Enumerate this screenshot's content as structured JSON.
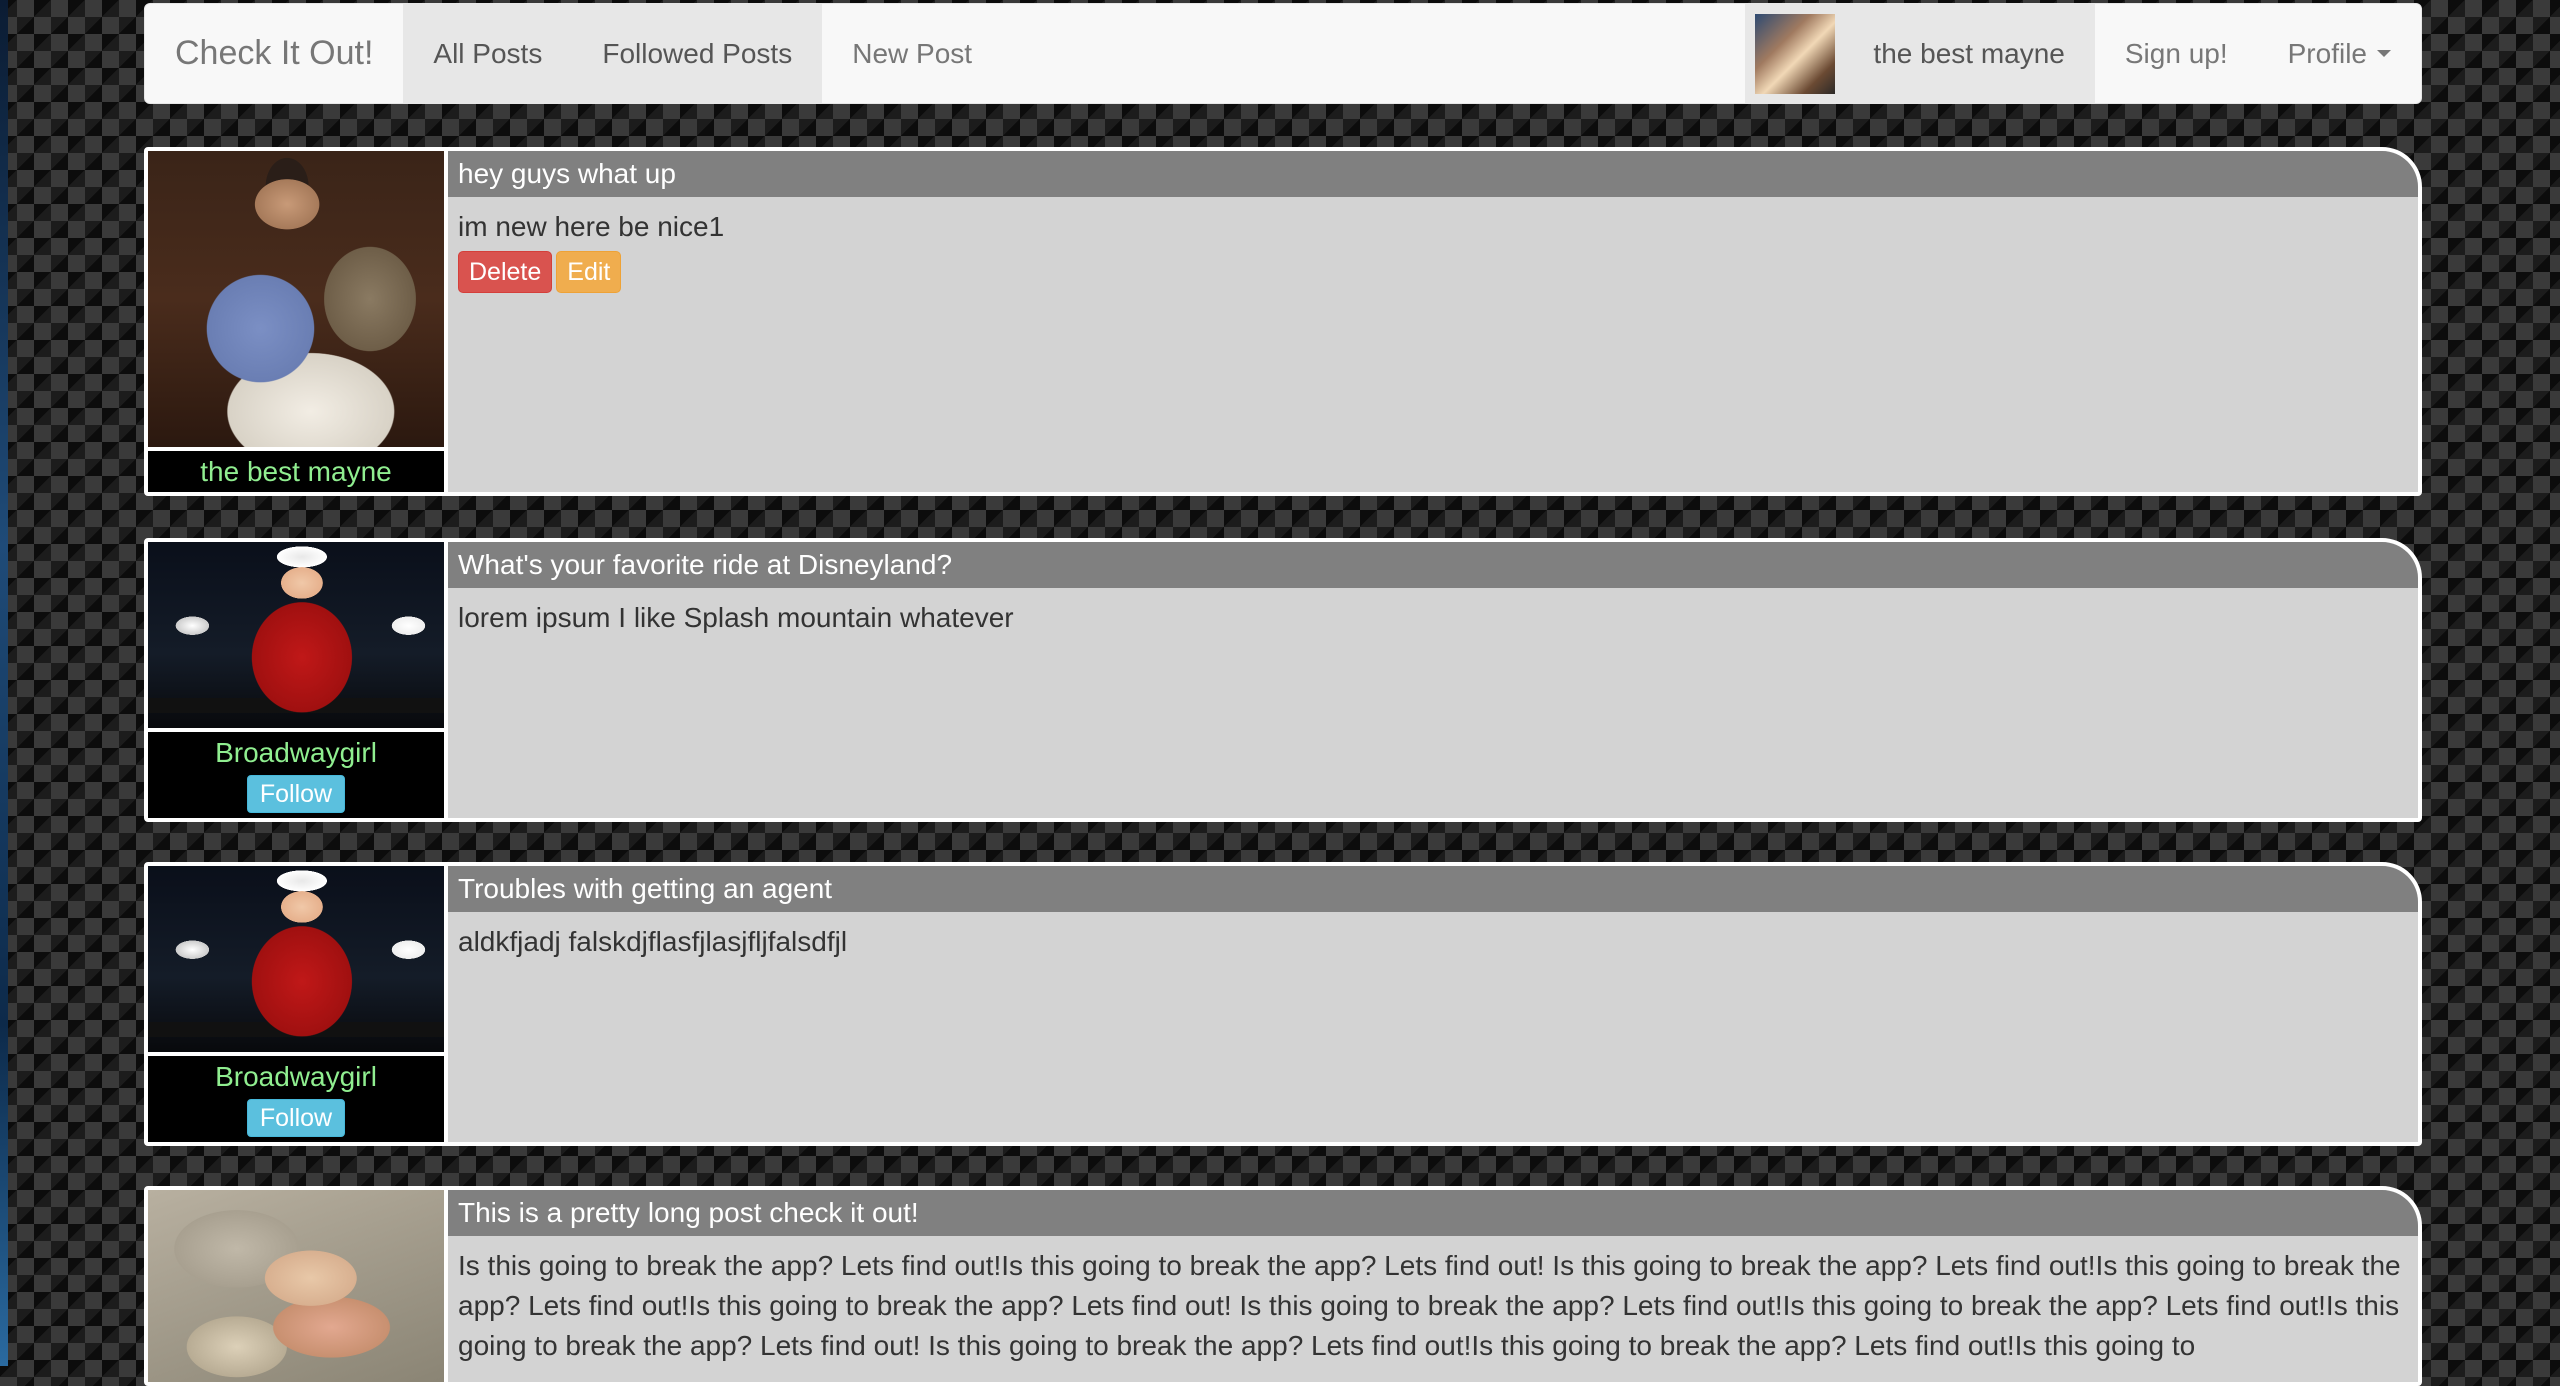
{
  "navbar": {
    "brand": "Check It Out!",
    "links": [
      {
        "label": "All Posts"
      },
      {
        "label": "Followed Posts"
      },
      {
        "label": "New Post"
      }
    ],
    "user_name": "the best mayne",
    "signup": "Sign up!",
    "profile": "Profile"
  },
  "posts": [
    {
      "author": "the best mayne",
      "title": "hey guys what up",
      "content": "im new here be nice1",
      "delete_label": "Delete",
      "edit_label": "Edit"
    },
    {
      "author": "Broadwaygirl",
      "follow_label": "Follow",
      "title": "What's your favorite ride at Disneyland?",
      "content": "lorem ipsum I like Splash mountain whatever"
    },
    {
      "author": "Broadwaygirl",
      "follow_label": "Follow",
      "title": "Troubles with getting an agent",
      "content": "aldkfjadj falskdjflasfjlasjfljfalsdfjl"
    },
    {
      "title": "This is a pretty long post check it out!",
      "content": "Is this going to break the app? Lets find out!Is this going to break the app? Lets find out! Is this going to break the app? Lets find out!Is this going to break the app? Lets find out!Is this going to break the app? Lets find out! Is this going to break the app? Lets find out!Is this going to break the app? Lets find out!Is this going to break the app? Lets find out! Is this going to break the app? Lets find out!Is this going to break the app? Lets find out!Is this going to"
    }
  ]
}
